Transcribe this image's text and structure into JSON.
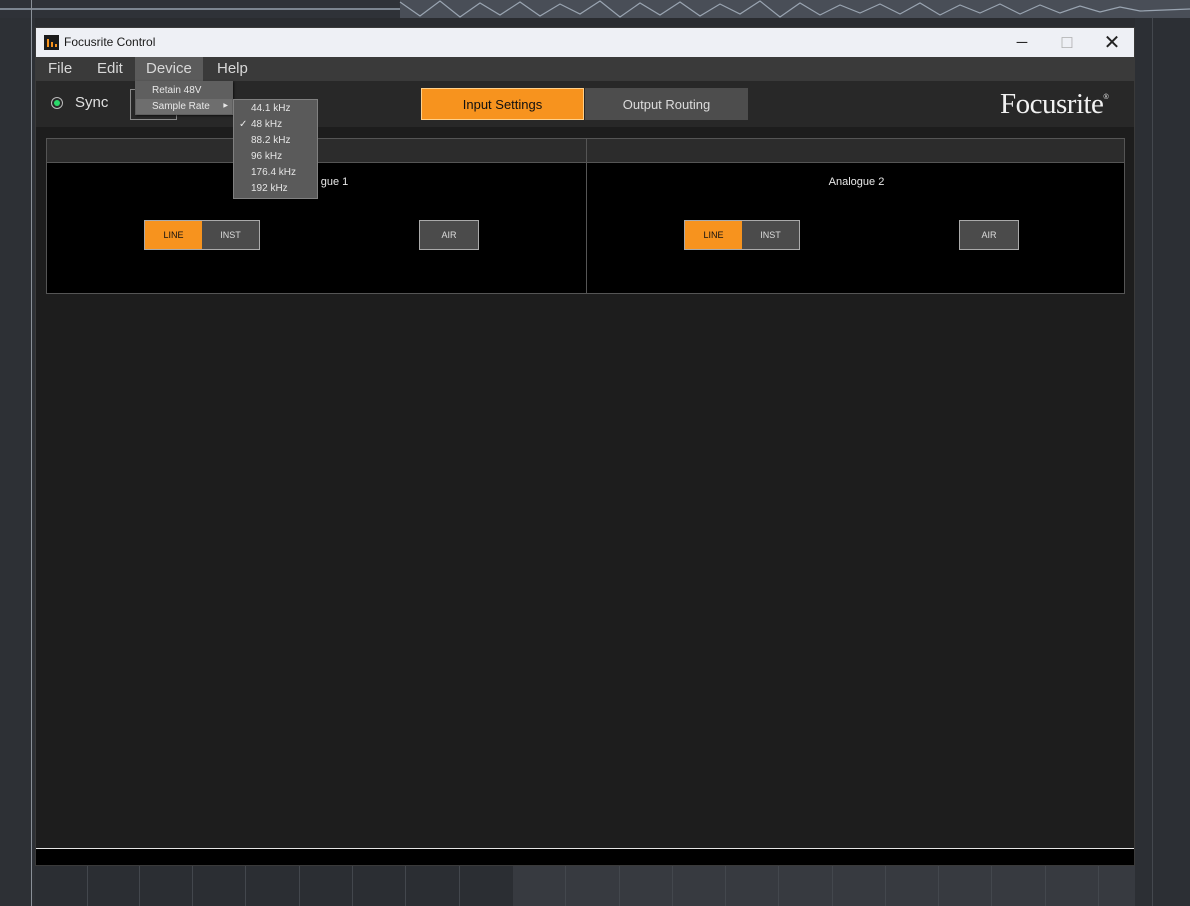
{
  "window": {
    "title": "Focusrite Control",
    "controls": {
      "minimize": "─",
      "maximize": "☐",
      "close": "✕"
    }
  },
  "menubar": {
    "items": [
      {
        "label": "File"
      },
      {
        "label": "Edit"
      },
      {
        "label": "Device",
        "active": true
      },
      {
        "label": "Help"
      }
    ]
  },
  "device_menu": {
    "items": [
      {
        "label": "Retain 48V"
      },
      {
        "label": "Sample Rate",
        "has_submenu": true
      }
    ]
  },
  "sample_rate_menu": {
    "items": [
      {
        "label": "44.1 kHz",
        "checked": false
      },
      {
        "label": "48 kHz",
        "checked": true
      },
      {
        "label": "88.2 kHz",
        "checked": false
      },
      {
        "label": "96 kHz",
        "checked": false
      },
      {
        "label": "176.4 kHz",
        "checked": false
      },
      {
        "label": "192 kHz",
        "checked": false
      }
    ],
    "check_glyph": "✓"
  },
  "toolbar": {
    "sync_label": "Sync",
    "sync_status_color": "#2bd96a",
    "tabs": [
      {
        "label": "Input Settings",
        "active": true
      },
      {
        "label": "Output Routing",
        "active": false
      }
    ],
    "logo_text": "Focusrite",
    "logo_mark": "®"
  },
  "channels": [
    {
      "name": "Analogue 1",
      "visible_name": "gue 1",
      "mode_buttons": [
        "LINE",
        "INST"
      ],
      "active_mode": "LINE",
      "air_label": "AIR"
    },
    {
      "name": "Analogue 2",
      "visible_name": "Analogue 2",
      "mode_buttons": [
        "LINE",
        "INST"
      ],
      "active_mode": "LINE",
      "air_label": "AIR"
    }
  ],
  "colors": {
    "accent": "#f7931e",
    "background": "#1d1d1d",
    "menubar": "#3a3a3a"
  }
}
